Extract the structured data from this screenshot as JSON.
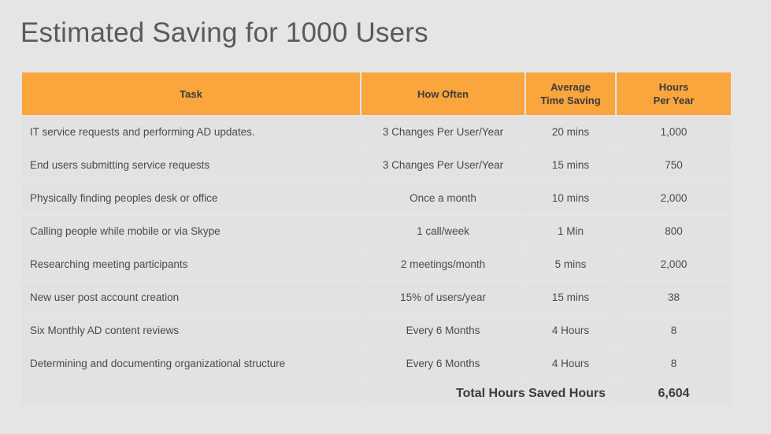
{
  "slide": {
    "title": "Estimated Saving for 1000 Users",
    "accent_color": "#fba63c",
    "background_color": "#e5e5e5",
    "cell_color": "#e2e2e2"
  },
  "table": {
    "headers": [
      "Task",
      "How Often",
      "Average\nTime Saving",
      "Hours\nPer Year"
    ],
    "headers_lines": [
      {
        "line1": "Task",
        "line2": ""
      },
      {
        "line1": "How Often",
        "line2": ""
      },
      {
        "line1": "Average",
        "line2": "Time Saving"
      },
      {
        "line1": "Hours",
        "line2": "Per Year"
      }
    ],
    "rows": [
      {
        "task": "IT service requests and performing AD updates.",
        "how_often": "3 Changes Per User/Year",
        "time_saving": "20 mins",
        "hours_per_year": "1,000"
      },
      {
        "task": "End users submitting service requests",
        "how_often": "3 Changes Per User/Year",
        "time_saving": "15 mins",
        "hours_per_year": "750"
      },
      {
        "task": "Physically finding peoples desk or office",
        "how_often": "Once a month",
        "time_saving": "10 mins",
        "hours_per_year": "2,000"
      },
      {
        "task": "Calling people while mobile or via Skype",
        "how_often": "1 call/week",
        "time_saving": "1 Min",
        "hours_per_year": "800"
      },
      {
        "task": "Researching meeting participants",
        "how_often": "2 meetings/month",
        "time_saving": "5 mins",
        "hours_per_year": "2,000"
      },
      {
        "task": "New user post account creation",
        "how_often": "15% of users/year",
        "time_saving": "15 mins",
        "hours_per_year": "38"
      },
      {
        "task": "Six Monthly AD content reviews",
        "how_often": "Every 6 Months",
        "time_saving": "4 Hours",
        "hours_per_year": "8"
      },
      {
        "task": "Determining and documenting organizational structure",
        "how_often": "Every 6 Months",
        "time_saving": "4 Hours",
        "hours_per_year": "8"
      }
    ],
    "total": {
      "blank": "",
      "label": "Total Hours Saved Hours",
      "value": "6,604"
    }
  }
}
